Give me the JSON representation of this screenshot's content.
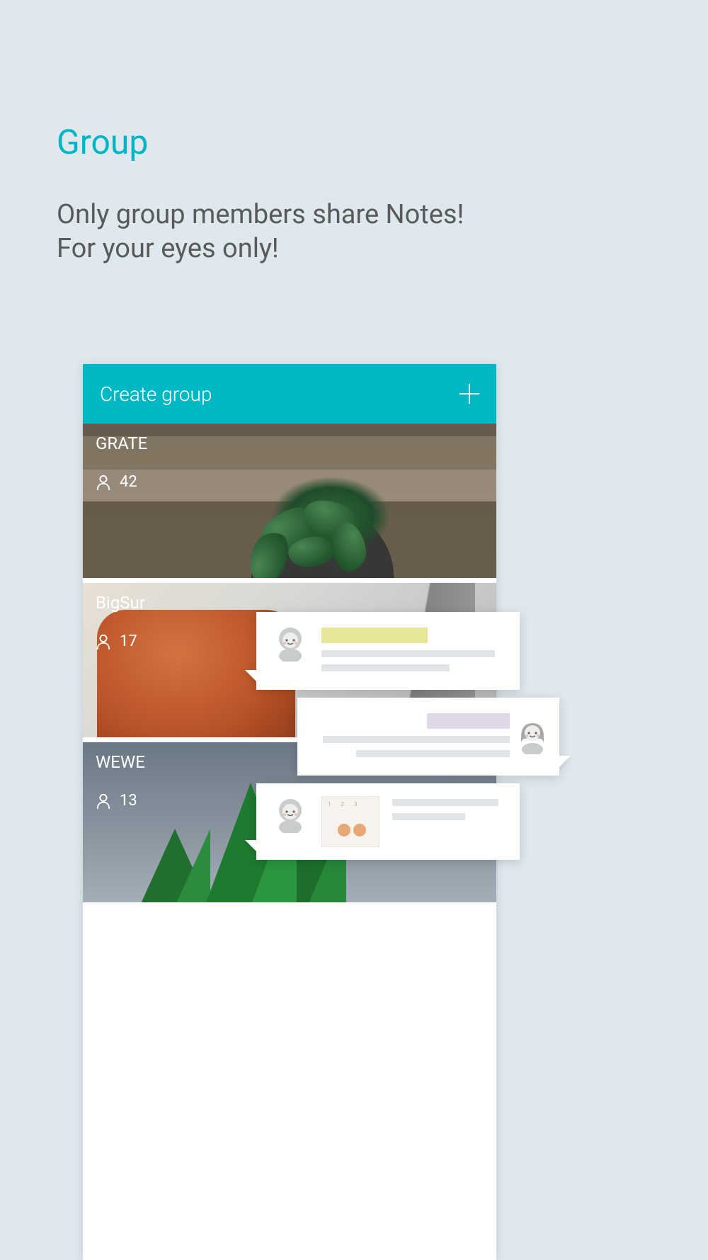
{
  "header": {
    "title": "Group",
    "description_line1": "Only group members share Notes!",
    "description_line2": "For your eyes only!"
  },
  "create_bar": {
    "label": "Create group"
  },
  "groups": [
    {
      "name": "GRATE",
      "members": "42"
    },
    {
      "name": "BigSur",
      "members": "17"
    },
    {
      "name": "WEWE",
      "members": "13"
    }
  ],
  "mini_card": {
    "numbers": "1 2 3"
  }
}
